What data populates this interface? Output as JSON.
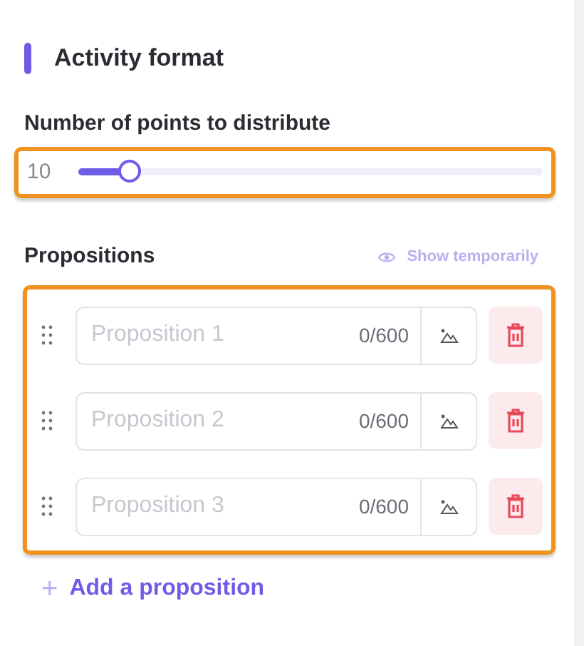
{
  "section_title": "Activity format",
  "points": {
    "label": "Number of points to distribute",
    "value": "10",
    "level": 0.11
  },
  "propositions": {
    "title": "Propositions",
    "toggle": "Show temporarily",
    "items": [
      {
        "placeholder": "Proposition 1",
        "counter": "0/600"
      },
      {
        "placeholder": "Proposition 2",
        "counter": "0/600"
      },
      {
        "placeholder": "Proposition 3",
        "counter": "0/600"
      }
    ],
    "add_label": "Add a proposition",
    "add_icon": "+"
  }
}
